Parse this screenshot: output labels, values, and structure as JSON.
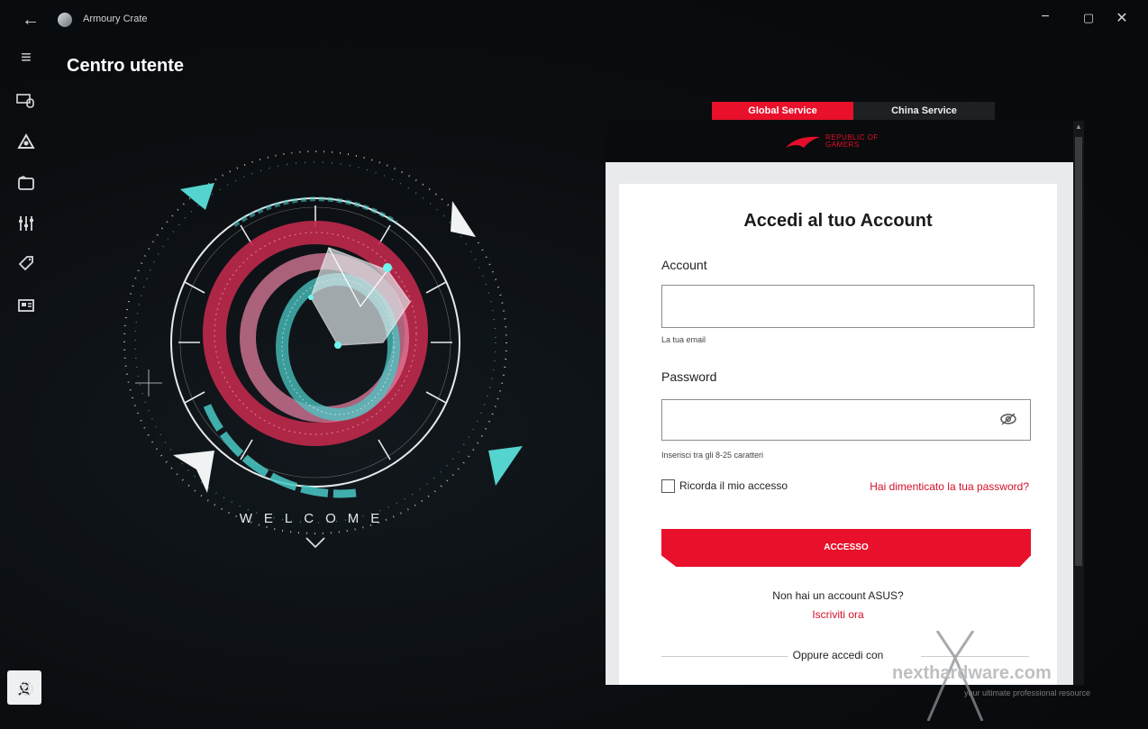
{
  "titlebar": {
    "back": "←",
    "app_title": "Armoury Crate",
    "minimize": "−",
    "maximize": "▢",
    "close": "✕"
  },
  "rail": {
    "menu": "≡",
    "items": [
      "device-icon",
      "aura-icon",
      "game-library-icon",
      "scenario-icon",
      "deals-icon",
      "news-icon"
    ],
    "user_center": "user-center-icon",
    "settings": "settings-icon"
  },
  "page": {
    "title": "Centro utente"
  },
  "art": {
    "welcome": "WELCOME"
  },
  "tabs": {
    "global": "Global Service",
    "china": "China Service"
  },
  "brand": {
    "line1": "REPUBLIC OF",
    "line2": "GAMERS"
  },
  "form": {
    "title": "Accedi al tuo Account",
    "account_label": "Account",
    "account_value": "",
    "account_hint": "La tua email",
    "password_label": "Password",
    "password_value": "",
    "password_hint": "Inserisci tra gli 8-25 caratteri",
    "remember": "Ricorda il mio accesso",
    "remember_checked": false,
    "forgot": "Hai dimenticato la tua password?",
    "login": "ACCESSO",
    "no_account": "Non hai un account ASUS?",
    "signup": "Iscriviti ora",
    "alt_login": "Oppure accedi con"
  },
  "watermark": {
    "brand": "nexthardware.com",
    "tagline": "your ultimate professional resource"
  },
  "colors": {
    "accent": "#e8102a",
    "teal": "#49c9c5",
    "crimson": "#c0294b",
    "bg": "#0b0e11"
  }
}
